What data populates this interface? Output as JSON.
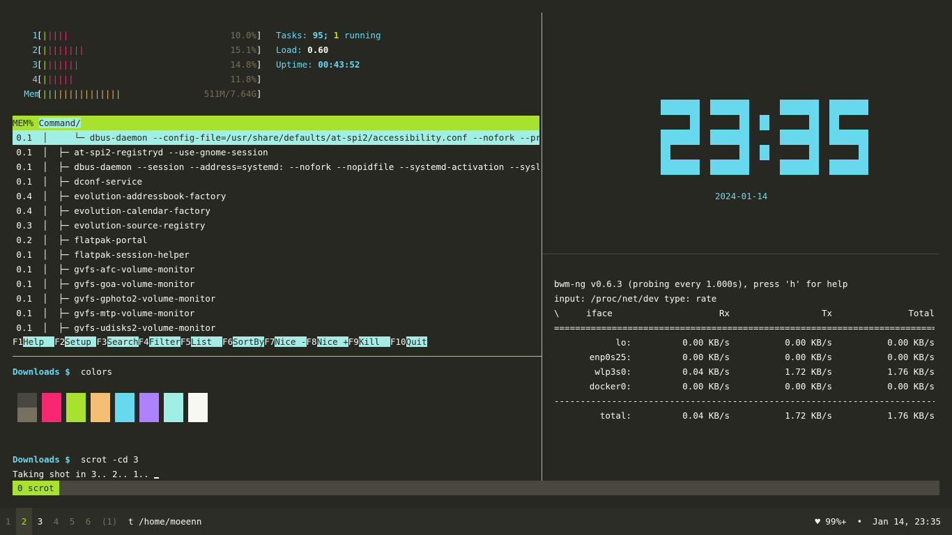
{
  "htop": {
    "cpus": [
      {
        "label": "1",
        "bars": "|||||",
        "value": "10.0%"
      },
      {
        "label": "2",
        "bars": "||||||||",
        "value": "15.1%"
      },
      {
        "label": "3",
        "bars": "|||||||",
        "value": "14.8%"
      },
      {
        "label": "4",
        "bars": "||||||",
        "value": "11.8%"
      }
    ],
    "mem": {
      "label": "Mem",
      "bars": "|||||||||||||||",
      "value": "511M/7.64G"
    },
    "tasks_label": "Tasks:",
    "tasks_count": "95;",
    "tasks_running": "1",
    "tasks_running_label": "running",
    "load_label": "Load:",
    "load_value": "0.60",
    "uptime_label": "Uptime:",
    "uptime_value": "00:43:52",
    "header": {
      "mem": "MEM%",
      "command": "Command/"
    },
    "rows": [
      {
        "mem": "0.1",
        "tree": "     └─ ",
        "cmd": "dbus-daemon --config-file=/usr/share/defaults/at-spi2/accessibility.conf --nofork --print-addr"
      },
      {
        "mem": "0.1",
        "tree": "  ├─ ",
        "cmd": "at-spi2-registryd --use-gnome-session"
      },
      {
        "mem": "0.1",
        "tree": "  ├─ ",
        "cmd": "dbus-daemon --session --address=systemd: --nofork --nopidfile --systemd-activation --syslog-only"
      },
      {
        "mem": "0.1",
        "tree": "  ├─ ",
        "cmd": "dconf-service"
      },
      {
        "mem": "0.4",
        "tree": "  ├─ ",
        "cmd": "evolution-addressbook-factory"
      },
      {
        "mem": "0.4",
        "tree": "  ├─ ",
        "cmd": "evolution-calendar-factory"
      },
      {
        "mem": "0.3",
        "tree": "  ├─ ",
        "cmd": "evolution-source-registry"
      },
      {
        "mem": "0.2",
        "tree": "  ├─ ",
        "cmd": "flatpak-portal"
      },
      {
        "mem": "0.1",
        "tree": "  ├─ ",
        "cmd": "flatpak-session-helper"
      },
      {
        "mem": "0.1",
        "tree": "  ├─ ",
        "cmd": "gvfs-afc-volume-monitor"
      },
      {
        "mem": "0.1",
        "tree": "  ├─ ",
        "cmd": "gvfs-goa-volume-monitor"
      },
      {
        "mem": "0.1",
        "tree": "  ├─ ",
        "cmd": "gvfs-gphoto2-volume-monitor"
      },
      {
        "mem": "0.1",
        "tree": "  ├─ ",
        "cmd": "gvfs-mtp-volume-monitor"
      },
      {
        "mem": "0.1",
        "tree": "  ├─ ",
        "cmd": "gvfs-udisks2-volume-monitor"
      }
    ],
    "fkeys": [
      {
        "key": "F1",
        "label": "Help  "
      },
      {
        "key": "F2",
        "label": "Setup "
      },
      {
        "key": "F3",
        "label": "Search"
      },
      {
        "key": "F4",
        "label": "Filter"
      },
      {
        "key": "F5",
        "label": "List  "
      },
      {
        "key": "F6",
        "label": "SortBy"
      },
      {
        "key": "F7",
        "label": "Nice -"
      },
      {
        "key": "F8",
        "label": "Nice +"
      },
      {
        "key": "F9",
        "label": "Kill  "
      },
      {
        "key": "F10",
        "label": "Quit"
      }
    ]
  },
  "shell": {
    "prompt_dir": "Downloads",
    "prompt_sym": "$",
    "cmd1": "colors",
    "cmd2": "scrot -cd 3",
    "output": "Taking shot in 3.. 2.. 1.. ",
    "swatch_colors": [
      "#49483e",
      "#f92672",
      "#a6e22e",
      "#f4bf75",
      "#66d9ef",
      "#ae81ff",
      "#a1efe4",
      "#f8f8f2"
    ]
  },
  "clock": {
    "time": "23:35",
    "date": "2024-01-14"
  },
  "bwm": {
    "line1": "bwm-ng v0.6.3 (probing every 1.000s), press 'h' for help",
    "line2": "input: /proc/net/dev type: rate",
    "headers": {
      "spin": "\\",
      "iface": "iface",
      "rx": "Rx",
      "tx": "Tx",
      "total": "Total"
    },
    "sep1": "==========================================================================",
    "rows": [
      {
        "iface": "lo:",
        "rx": "0.00 KB/s",
        "tx": "0.00 KB/s",
        "total": "0.00 KB/s"
      },
      {
        "iface": "enp0s25:",
        "rx": "0.00 KB/s",
        "tx": "0.00 KB/s",
        "total": "0.00 KB/s"
      },
      {
        "iface": "wlp3s0:",
        "rx": "0.04 KB/s",
        "tx": "1.72 KB/s",
        "total": "1.76 KB/s"
      },
      {
        "iface": "docker0:",
        "rx": "0.00 KB/s",
        "tx": "0.00 KB/s",
        "total": "0.00 KB/s"
      }
    ],
    "sep2": "--------------------------------------------------------------------------",
    "total": {
      "iface": "total:",
      "rx": "0.04 KB/s",
      "tx": "1.72 KB/s",
      "total": "1.76 KB/s"
    }
  },
  "tmux": {
    "window": "0 scrot"
  },
  "bar": {
    "workspaces": [
      "1",
      "2",
      "3",
      "4",
      "5",
      "6",
      "(1)"
    ],
    "active_index": 1,
    "title": "t /home/moeenn",
    "battery": "♥ 99%+",
    "bullet": "•",
    "datetime": "Jan 14, 23:35"
  }
}
